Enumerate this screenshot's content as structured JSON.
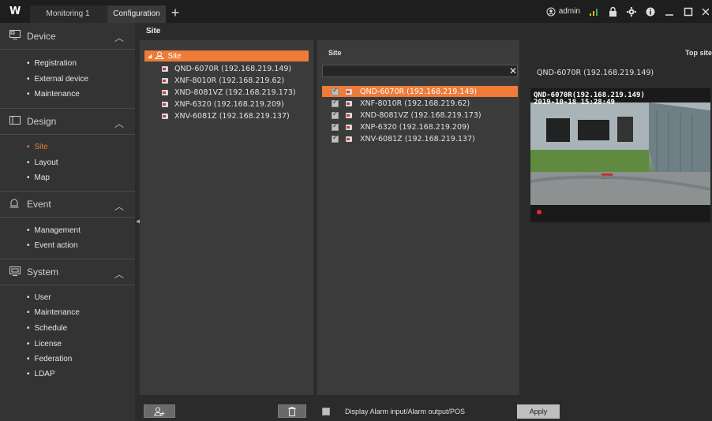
{
  "app": {
    "logo": "W",
    "tabs": [
      {
        "label": "Monitoring 1"
      },
      {
        "label": "Configuration"
      }
    ],
    "add_tab": "+",
    "user": "admin",
    "icons": [
      "user-icon",
      "network-icon",
      "lock-icon",
      "gear-icon",
      "info-icon",
      "minimize-icon",
      "maximize-icon",
      "close-icon"
    ]
  },
  "sidebar": {
    "sections": [
      {
        "title": "Device",
        "icon": "device-icon",
        "items": [
          "Registration",
          "External device",
          "Maintenance"
        ]
      },
      {
        "title": "Design",
        "icon": "design-icon",
        "items": [
          "Site",
          "Layout",
          "Map"
        ],
        "active": "Site"
      },
      {
        "title": "Event",
        "icon": "event-icon",
        "items": [
          "Management",
          "Event action"
        ]
      },
      {
        "title": "System",
        "icon": "system-icon",
        "items": [
          "User",
          "Maintenance",
          "Schedule",
          "License",
          "Federation",
          "LDAP"
        ]
      }
    ]
  },
  "site_panel": {
    "title": "Site",
    "tree_root": "Site",
    "devices": [
      "QND-6070R (192.168.219.149)",
      "XNF-8010R (192.168.219.62)",
      "XND-8081VZ (192.168.219.173)",
      "XNP-6320 (192.168.219.209)",
      "XNV-6081Z (192.168.219.137)"
    ]
  },
  "list_panel": {
    "label": "Site",
    "search_value": "",
    "clear": "✕",
    "rows": [
      {
        "label": "QND-6070R (192.168.219.149)",
        "checked": true,
        "selected": true
      },
      {
        "label": "XNF-8010R (192.168.219.62)",
        "checked": true,
        "selected": false
      },
      {
        "label": "XND-8081VZ (192.168.219.173)",
        "checked": true,
        "selected": false
      },
      {
        "label": "XNP-6320 (192.168.219.209)",
        "checked": true,
        "selected": false
      },
      {
        "label": "XNV-6081Z (192.168.219.137)",
        "checked": true,
        "selected": false
      }
    ]
  },
  "preview": {
    "top_label": "Top site",
    "camera_title": "QND-6070R (192.168.219.149)",
    "osd_name": "QND-6070R(192.168.219.149)",
    "osd_time": "2019-10-18 15:28:49"
  },
  "footer": {
    "alarm_label": "Display Alarm input/Alarm output/POS",
    "apply_label": "Apply"
  },
  "colors": {
    "accent": "#ee7b37",
    "background": "#2b2b2b",
    "panel": "#3b3b3b",
    "sidebar": "#333333",
    "record": "#e52b2b"
  }
}
